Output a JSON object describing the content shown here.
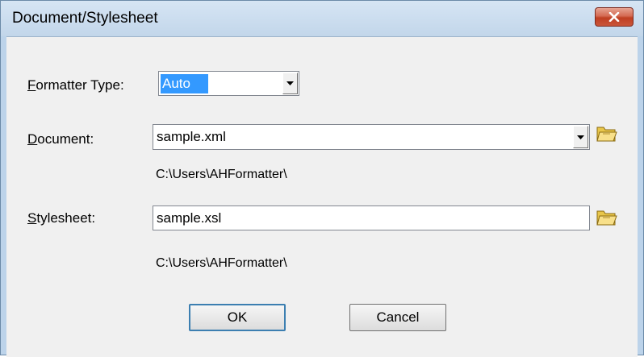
{
  "window": {
    "title": "Document/Stylesheet"
  },
  "formatter": {
    "label_accel": "F",
    "label_rest": "ormatter Type:",
    "value": "Auto"
  },
  "document": {
    "label_accel": "D",
    "label_rest": "ocument:",
    "value": "sample.xml",
    "path": "C:\\Users\\AHFormatter\\"
  },
  "stylesheet": {
    "label_accel": "S",
    "label_rest": "tylesheet:",
    "value": "sample.xsl",
    "path": "C:\\Users\\AHFormatter\\"
  },
  "buttons": {
    "ok_label": "OK",
    "cancel_label": "Cancel"
  },
  "icons": {
    "close": "close-icon",
    "dropdown": "chevron-down-icon",
    "browse": "folder-open-icon"
  },
  "colors": {
    "selection": "#3399ff",
    "close_button": "#c9553a",
    "dialog_background": "#f0f0f0"
  }
}
